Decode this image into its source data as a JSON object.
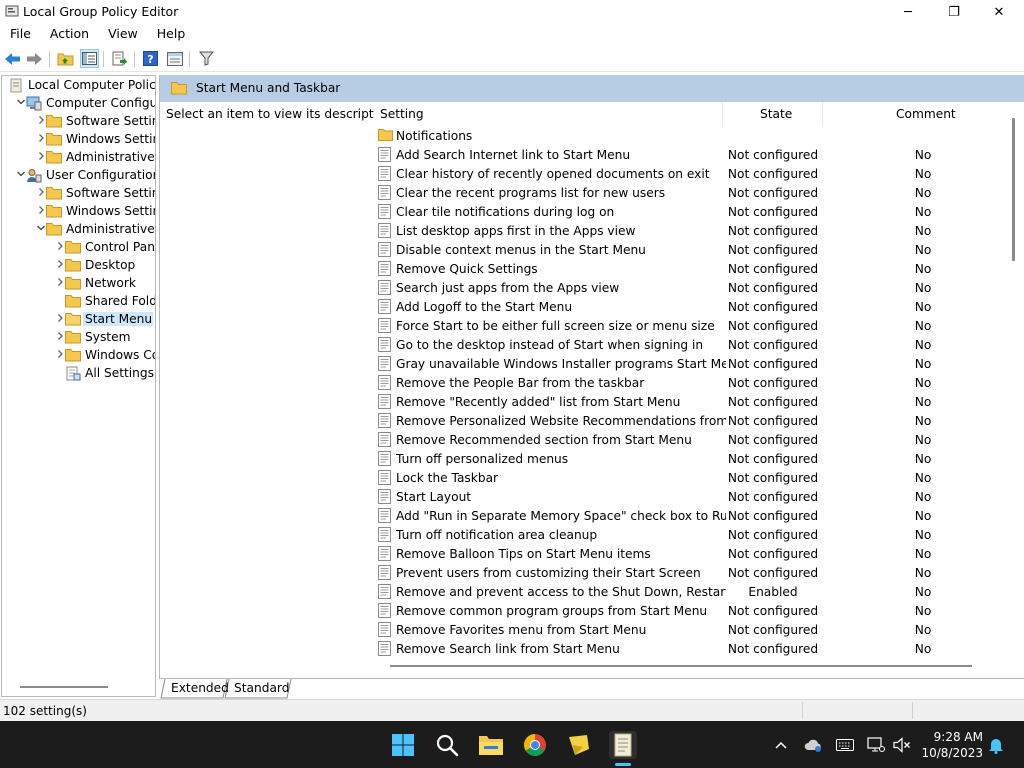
{
  "window": {
    "title": "Local Group Policy Editor",
    "minimize_glyph": "─",
    "maximize_glyph": "❐",
    "close_glyph": "✕"
  },
  "menu": [
    "File",
    "Action",
    "View",
    "Help"
  ],
  "tree": [
    {
      "label": "Local Computer Policy",
      "depth": 0,
      "expander": "",
      "icon": "computer-policy-icon"
    },
    {
      "label": "Computer Configura",
      "depth": 1,
      "expander": "expanded",
      "icon": "computer-config-icon"
    },
    {
      "label": "Software Settings",
      "depth": 2,
      "expander": "collapsed",
      "icon": "folder-icon"
    },
    {
      "label": "Windows Setting",
      "depth": 2,
      "expander": "collapsed",
      "icon": "folder-icon"
    },
    {
      "label": "Administrative Te",
      "depth": 2,
      "expander": "collapsed",
      "icon": "folder-icon"
    },
    {
      "label": "User Configuration",
      "depth": 1,
      "expander": "expanded",
      "icon": "user-config-icon"
    },
    {
      "label": "Software Settings",
      "depth": 2,
      "expander": "collapsed",
      "icon": "folder-icon"
    },
    {
      "label": "Windows Setting",
      "depth": 2,
      "expander": "collapsed",
      "icon": "folder-icon"
    },
    {
      "label": "Administrative Te",
      "depth": 2,
      "expander": "expanded",
      "icon": "folder-icon"
    },
    {
      "label": "Control Panel",
      "depth": 3,
      "expander": "collapsed",
      "icon": "folder-icon"
    },
    {
      "label": "Desktop",
      "depth": 3,
      "expander": "collapsed",
      "icon": "folder-icon"
    },
    {
      "label": "Network",
      "depth": 3,
      "expander": "collapsed",
      "icon": "folder-icon"
    },
    {
      "label": "Shared Folder",
      "depth": 3,
      "expander": "",
      "icon": "folder-icon"
    },
    {
      "label": "Start Menu ar",
      "depth": 3,
      "expander": "collapsed",
      "icon": "folder-open-icon",
      "selected": true
    },
    {
      "label": "System",
      "depth": 3,
      "expander": "collapsed",
      "icon": "folder-icon"
    },
    {
      "label": "Windows Cor",
      "depth": 3,
      "expander": "collapsed",
      "icon": "folder-icon"
    },
    {
      "label": "All Settings",
      "depth": 3,
      "expander": "",
      "icon": "all-settings-icon"
    }
  ],
  "right_header": "Start Menu and Taskbar",
  "description": "Select an item to view its description.",
  "columns": {
    "setting": "Setting",
    "state": "State",
    "comment": "Comment"
  },
  "rows": [
    {
      "setting": "Notifications",
      "state": "",
      "comment": "",
      "type": "folder"
    },
    {
      "setting": "Add Search Internet link to Start Menu",
      "state": "Not configured",
      "comment": "No"
    },
    {
      "setting": "Clear history of recently opened documents on exit",
      "state": "Not configured",
      "comment": "No"
    },
    {
      "setting": "Clear the recent programs list for new users",
      "state": "Not configured",
      "comment": "No"
    },
    {
      "setting": "Clear tile notifications during log on",
      "state": "Not configured",
      "comment": "No"
    },
    {
      "setting": "List desktop apps first in the Apps view",
      "state": "Not configured",
      "comment": "No"
    },
    {
      "setting": "Disable context menus in the Start Menu",
      "state": "Not configured",
      "comment": "No"
    },
    {
      "setting": "Remove Quick Settings",
      "state": "Not configured",
      "comment": "No"
    },
    {
      "setting": "Search just apps from the Apps view",
      "state": "Not configured",
      "comment": "No"
    },
    {
      "setting": "Add Logoff to the Start Menu",
      "state": "Not configured",
      "comment": "No"
    },
    {
      "setting": "Force Start to be either full screen size or menu size",
      "state": "Not configured",
      "comment": "No"
    },
    {
      "setting": "Go to the desktop instead of Start when signing in",
      "state": "Not configured",
      "comment": "No"
    },
    {
      "setting": "Gray unavailable Windows Installer programs Start Menu sh...",
      "state": "Not configured",
      "comment": "No"
    },
    {
      "setting": "Remove the People Bar from the taskbar",
      "state": "Not configured",
      "comment": "No"
    },
    {
      "setting": "Remove \"Recently added\" list from Start Menu",
      "state": "Not configured",
      "comment": "No"
    },
    {
      "setting": "Remove Personalized Website Recommendations from the ...",
      "state": "Not configured",
      "comment": "No"
    },
    {
      "setting": "Remove Recommended section from Start Menu",
      "state": "Not configured",
      "comment": "No"
    },
    {
      "setting": "Turn off personalized menus",
      "state": "Not configured",
      "comment": "No"
    },
    {
      "setting": "Lock the Taskbar",
      "state": "Not configured",
      "comment": "No"
    },
    {
      "setting": "Start Layout",
      "state": "Not configured",
      "comment": "No"
    },
    {
      "setting": "Add \"Run in Separate Memory Space\" check box to Run dial...",
      "state": "Not configured",
      "comment": "No"
    },
    {
      "setting": "Turn off notification area cleanup",
      "state": "Not configured",
      "comment": "No"
    },
    {
      "setting": "Remove Balloon Tips on Start Menu items",
      "state": "Not configured",
      "comment": "No"
    },
    {
      "setting": "Prevent users from customizing their Start Screen",
      "state": "Not configured",
      "comment": "No"
    },
    {
      "setting": "Remove and prevent access to the Shut Down, Restart, Sleep...",
      "state": "Enabled",
      "comment": "No"
    },
    {
      "setting": "Remove common program groups from Start Menu",
      "state": "Not configured",
      "comment": "No"
    },
    {
      "setting": "Remove Favorites menu from Start Menu",
      "state": "Not configured",
      "comment": "No"
    },
    {
      "setting": "Remove Search link from Start Menu",
      "state": "Not configured",
      "comment": "No"
    }
  ],
  "tabs": [
    "Extended",
    "Standard"
  ],
  "status": "102 setting(s)",
  "clock": {
    "time": "9:28 AM",
    "date": "10/8/2023"
  },
  "colors": {
    "header_bar": "#b7cde4",
    "selection": "#cce8ff",
    "taskbar": "#1c1c1c",
    "folder": "#f4c84e",
    "accent": "#4cc2ff"
  }
}
